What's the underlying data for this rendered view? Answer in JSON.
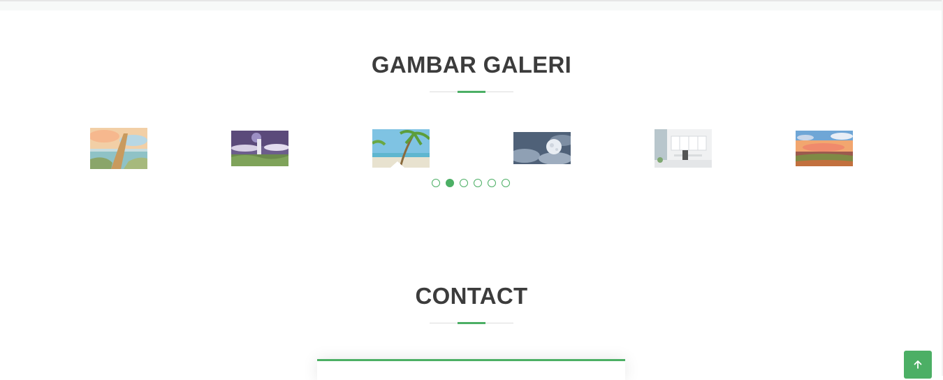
{
  "gallery": {
    "title": "GAMBAR GALERI",
    "images": [
      {
        "name": "stairway-painting"
      },
      {
        "name": "purple-night-tower"
      },
      {
        "name": "palm-beach"
      },
      {
        "name": "full-moon-clouds"
      },
      {
        "name": "white-office"
      },
      {
        "name": "sunset-field"
      }
    ],
    "pagination": {
      "count": 6,
      "active_index": 1
    }
  },
  "contact": {
    "title": "CONTACT"
  },
  "back_to_top": {
    "icon": "arrow-up-icon"
  },
  "colors": {
    "accent": "#4caf65",
    "title": "#3c3c3c"
  }
}
